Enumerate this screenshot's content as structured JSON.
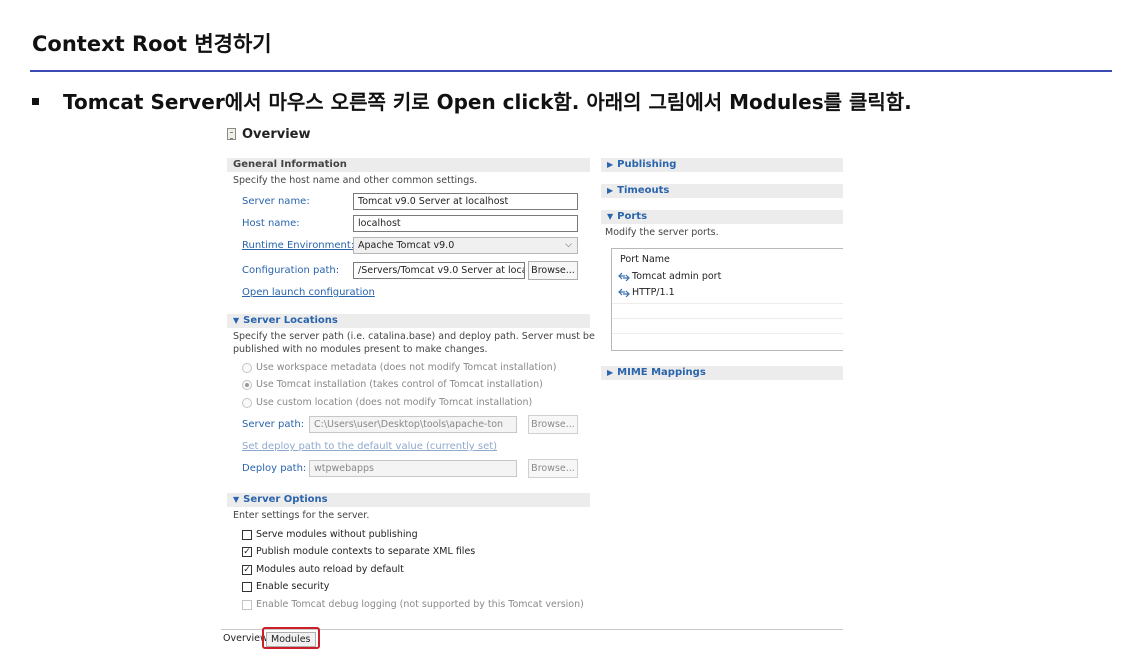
{
  "slide": {
    "title": "Context Root 변경하기",
    "bullet": "Tomcat Server에서 마우스 오른쪽 키로 Open click함. 아래의 그림에서 Modules를 클릭함."
  },
  "editor": {
    "title": "Overview",
    "general": {
      "header": "General Information",
      "desc": "Specify the host name and other common settings.",
      "server_name_label": "Server name:",
      "server_name_value": "Tomcat v9.0 Server at localhost",
      "host_name_label": "Host name:",
      "host_name_value": "localhost",
      "runtime_label": "Runtime Environment:",
      "runtime_value": "Apache Tomcat v9.0",
      "config_label": "Configuration path:",
      "config_value": "/Servers/Tomcat v9.0 Server at local",
      "browse_label": "Browse...",
      "open_launch_label": "Open launch configuration"
    },
    "locations": {
      "header": "Server Locations",
      "desc_line1": "Specify the server path (i.e. catalina.base) and deploy path. Server must be",
      "desc_line2": "published with no modules present to make changes.",
      "opt_workspace": "Use workspace metadata (does not modify Tomcat installation)",
      "opt_tomcat": "Use Tomcat installation (takes control of Tomcat installation)",
      "opt_custom": "Use custom location (does not modify Tomcat installation)",
      "server_path_label": "Server path:",
      "server_path_value": "C:\\Users\\user\\Desktop\\tools\\apache-ton",
      "set_deploy_label": "Set deploy path to the default value (currently set)",
      "deploy_path_label": "Deploy path:",
      "deploy_path_value": "wtpwebapps",
      "browse_label": "Browse..."
    },
    "options": {
      "header": "Server Options",
      "desc": "Enter settings for the server.",
      "serve_modules": "Serve modules without publishing",
      "publish_contexts": "Publish module contexts to separate XML files",
      "auto_reload": "Modules auto reload by default",
      "enable_security": "Enable security",
      "debug_logging": "Enable Tomcat debug logging (not supported by this Tomcat version)"
    },
    "right": {
      "publishing": "Publishing",
      "timeouts": "Timeouts",
      "ports_header": "Ports",
      "ports_desc": "Modify the server ports.",
      "ports_col": "Port Name",
      "ports_rows": [
        "Tomcat admin port",
        "HTTP/1.1"
      ],
      "mime": "MIME Mappings"
    },
    "tabs": {
      "overview": "Overview",
      "modules": "Modules"
    }
  },
  "colors": {
    "slide_rule": "#3b4bb3",
    "link_blue": "#2a64ad",
    "highlight_red": "#cc1f2a"
  }
}
